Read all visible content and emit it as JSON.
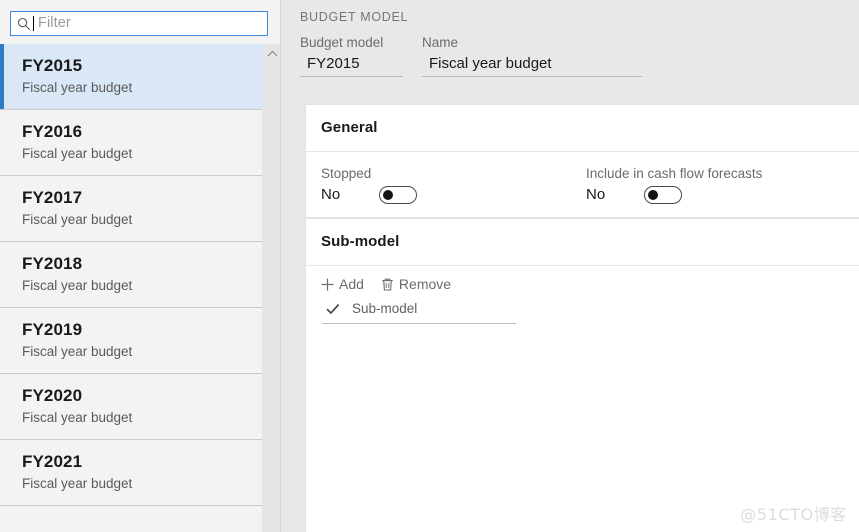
{
  "sidebar": {
    "filter": {
      "placeholder": "Filter",
      "value": "",
      "icon": "search-icon"
    },
    "scroll": {
      "up_icon": "chevron-up-icon"
    },
    "items": [
      {
        "title": "FY2015",
        "subtitle": "Fiscal year budget",
        "selected": true
      },
      {
        "title": "FY2016",
        "subtitle": "Fiscal year budget",
        "selected": false
      },
      {
        "title": "FY2017",
        "subtitle": "Fiscal year budget",
        "selected": false
      },
      {
        "title": "FY2018",
        "subtitle": "Fiscal year budget",
        "selected": false
      },
      {
        "title": "FY2019",
        "subtitle": "Fiscal year budget",
        "selected": false
      },
      {
        "title": "FY2020",
        "subtitle": "Fiscal year budget",
        "selected": false
      },
      {
        "title": "FY2021",
        "subtitle": "Fiscal year budget",
        "selected": false
      }
    ]
  },
  "header": {
    "caption": "BUDGET MODEL",
    "fields": [
      {
        "label": "Budget model",
        "value": "FY2015"
      },
      {
        "label": "Name",
        "value": "Fiscal year budget"
      }
    ]
  },
  "general": {
    "title": "General",
    "toggles": [
      {
        "label": "Stopped",
        "value": "No",
        "state": "off"
      },
      {
        "label": "Include in cash flow forecasts",
        "value": "No",
        "state": "off"
      }
    ]
  },
  "submodel": {
    "title": "Sub-model",
    "toolbar": [
      {
        "label": "Add",
        "icon": "plus-icon"
      },
      {
        "label": "Remove",
        "icon": "trash-icon"
      }
    ],
    "grid": {
      "check_icon": "checkmark-icon",
      "columns": [
        "Sub-model"
      ],
      "rows": []
    }
  },
  "watermark": {
    "text": "@51CTO博客"
  },
  "colors": {
    "accent": "#2f7bc4",
    "selection_bg": "#d9e7f6",
    "sidebar_bg": "#f3f3f3",
    "page_bg": "#e8e8e8",
    "card_bg": "#ffffff",
    "muted_text": "#6b6b6b"
  }
}
